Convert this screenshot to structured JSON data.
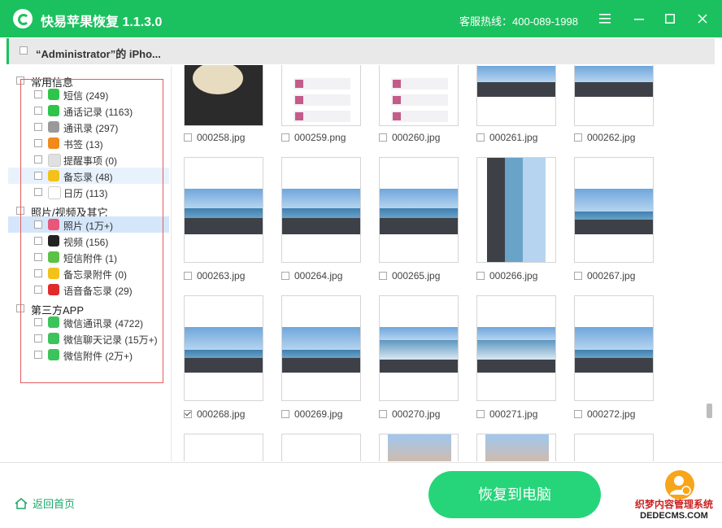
{
  "app": {
    "title": "快易苹果恢复 1.1.3.0",
    "hotline": "客服热线：400-089-1998"
  },
  "device": {
    "name": "“Administrator”的 iPho..."
  },
  "sidebar": {
    "cat_common": "常用信息",
    "cat_media": "照片/视频及其它",
    "cat_third": "第三方APP",
    "items": [
      {
        "label": "短信 (249)",
        "color": "#2ec54a"
      },
      {
        "label": "通话记录 (1163)",
        "color": "#2ec54a"
      },
      {
        "label": "通讯录 (297)",
        "color": "#9a9a9a"
      },
      {
        "label": "书签 (13)",
        "color": "#f08a1a"
      },
      {
        "label": "提醒事项 (0)",
        "color": "#e0e0e0"
      },
      {
        "label": "备忘录 (48)",
        "color": "#f2c21a"
      },
      {
        "label": "日历 (113)",
        "color": "#ffffff"
      },
      {
        "label": "照片 (1万+)",
        "color": "#e8577a"
      },
      {
        "label": "视频 (156)",
        "color": "#222222"
      },
      {
        "label": "短信附件 (1)",
        "color": "#5bc247"
      },
      {
        "label": "备忘录附件 (0)",
        "color": "#f2c21a"
      },
      {
        "label": "语音备忘录 (29)",
        "color": "#e02b2b"
      },
      {
        "label": "微信通讯录 (4722)",
        "color": "#3cc45c"
      },
      {
        "label": "微信聊天记录 (15万+)",
        "color": "#3cc45c"
      },
      {
        "label": "微信附件 (2万+)",
        "color": "#3cc45c"
      }
    ]
  },
  "files": [
    {
      "name": "000258.jpg",
      "checked": false
    },
    {
      "name": "000259.png",
      "checked": false
    },
    {
      "name": "000260.jpg",
      "checked": false
    },
    {
      "name": "000261.jpg",
      "checked": false
    },
    {
      "name": "000262.jpg",
      "checked": false
    },
    {
      "name": "000263.jpg",
      "checked": false
    },
    {
      "name": "000264.jpg",
      "checked": false
    },
    {
      "name": "000265.jpg",
      "checked": false
    },
    {
      "name": "000266.jpg",
      "checked": false
    },
    {
      "name": "000267.jpg",
      "checked": false
    },
    {
      "name": "000268.jpg",
      "checked": true
    },
    {
      "name": "000269.jpg",
      "checked": false
    },
    {
      "name": "000270.jpg",
      "checked": false
    },
    {
      "name": "000271.jpg",
      "checked": false
    },
    {
      "name": "000272.jpg",
      "checked": false
    }
  ],
  "footer": {
    "home_label": "返回首页",
    "recover_label": "恢复到电脑"
  },
  "watermark": {
    "line1": "织梦内容管理系统",
    "line2": "DEDECMS.COM"
  },
  "colors": {
    "brand_green": "#1cc15f",
    "button_green": "#26d57a",
    "highlight_box": "#e25c5c"
  }
}
